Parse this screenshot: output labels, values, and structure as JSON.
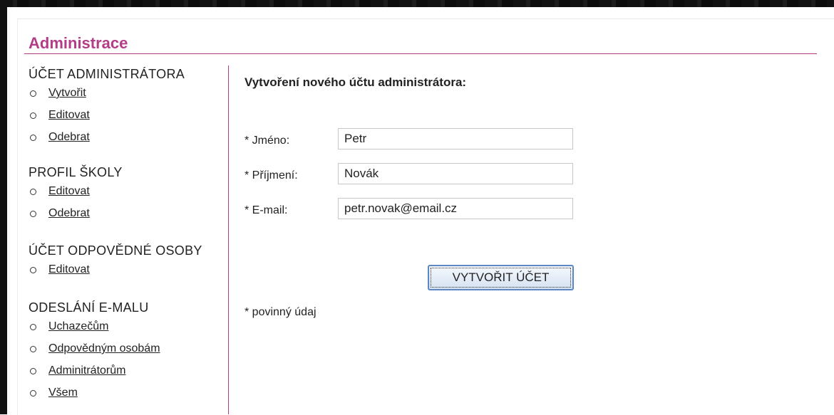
{
  "header": {
    "title": "Administrace"
  },
  "sidebar": {
    "sections": [
      {
        "title": "ÚČET ADMINISTRÁTORA",
        "items": [
          "Vytvořit",
          "Editovat",
          "Odebrat"
        ]
      },
      {
        "title": "PROFIL ŠKOLY",
        "items": [
          "Editovat",
          "Odebrat"
        ]
      },
      {
        "title": "ÚČET ODPOVĚDNÉ OSOBY",
        "items": [
          "Editovat"
        ]
      },
      {
        "title": "ODESLÁNÍ E-MALU",
        "items": [
          "Uchazečům",
          "Odpovědným osobám",
          "Adminitrátorům",
          "Všem"
        ]
      }
    ]
  },
  "form": {
    "heading": "Vytvoření nového účtu administrátora:",
    "fields": {
      "first_name": {
        "label": "* Jméno:",
        "value": "Petr"
      },
      "last_name": {
        "label": "* Příjmení:",
        "value": "Novák"
      },
      "email": {
        "label": "* E-mail:",
        "value": "petr.novak@email.cz"
      }
    },
    "submit_label": "VYTVOŘIT ÚČET",
    "required_note": "* povinný údaj"
  },
  "colors": {
    "accent": "#b33d87",
    "button_border": "#5d87c2"
  }
}
